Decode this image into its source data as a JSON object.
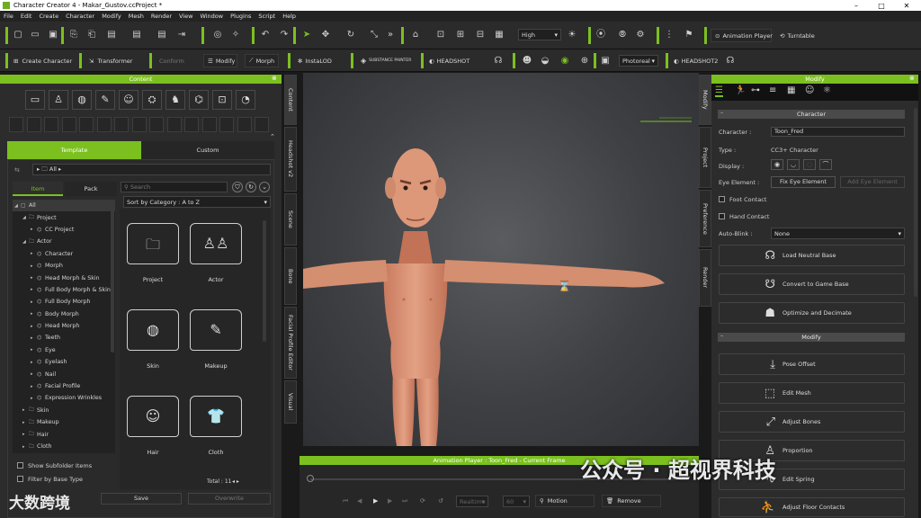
{
  "window": {
    "title": "Character Creator 4 - Makar_Gustov.ccProject *",
    "minimize": "–",
    "maximize": "□",
    "close": "✕"
  },
  "menu": [
    "File",
    "Edit",
    "Create",
    "Character",
    "Modify",
    "Mesh",
    "Render",
    "View",
    "Window",
    "Plugins",
    "Script",
    "Help"
  ],
  "toolbar1": {
    "quality": "High",
    "animation_player": "Animation Player",
    "turntable": "Turntable"
  },
  "toolbar2": {
    "create_character": "Create Character",
    "transformer": "Transformer",
    "conform": "Conform",
    "modify": "Modify",
    "morph": "Morph",
    "instalod": "InstaLOD",
    "substance_painter": "SUBSTANCE PAINTER",
    "headshot": "HEADSHOT",
    "render_mode": "Photoreal",
    "headshot2": "HEADSHOT2"
  },
  "content_panel": {
    "title": "Content",
    "tabs": {
      "template": "Template",
      "custom": "Custom"
    },
    "path": "All",
    "subtabs": {
      "item": "Item",
      "pack": "Pack"
    },
    "search_placeholder": "Search",
    "sort": "Sort by Category : A to Z",
    "tree": [
      {
        "label": "All",
        "depth": 0,
        "open": true
      },
      {
        "label": "Project",
        "depth": 1,
        "open": true
      },
      {
        "label": "CC Project",
        "depth": 2,
        "open": false
      },
      {
        "label": "Actor",
        "depth": 1,
        "open": true
      },
      {
        "label": "Character",
        "depth": 2,
        "open": false
      },
      {
        "label": "Morph",
        "depth": 2,
        "open": false
      },
      {
        "label": "Head Morph & Skin",
        "depth": 2,
        "open": false
      },
      {
        "label": "Full Body Morph & Skin",
        "depth": 2,
        "open": false
      },
      {
        "label": "Full Body Morph",
        "depth": 2,
        "open": false
      },
      {
        "label": "Body Morph",
        "depth": 2,
        "open": false
      },
      {
        "label": "Head Morph",
        "depth": 2,
        "open": false
      },
      {
        "label": "Teeth",
        "depth": 2,
        "open": false
      },
      {
        "label": "Eye",
        "depth": 2,
        "open": false
      },
      {
        "label": "Eyelash",
        "depth": 2,
        "open": false
      },
      {
        "label": "Nail",
        "depth": 2,
        "open": false
      },
      {
        "label": "Facial Profile",
        "depth": 2,
        "open": false
      },
      {
        "label": "Expression Wrinkles",
        "depth": 2,
        "open": false
      },
      {
        "label": "Skin",
        "depth": 1,
        "open": false
      },
      {
        "label": "Makeup",
        "depth": 1,
        "open": false
      },
      {
        "label": "Hair",
        "depth": 1,
        "open": false
      },
      {
        "label": "Cloth",
        "depth": 1,
        "open": false
      }
    ],
    "items": [
      {
        "label": "Project",
        "glyph": "🗀"
      },
      {
        "label": "Actor",
        "glyph": "♙♙"
      },
      {
        "label": "Skin",
        "glyph": "◍"
      },
      {
        "label": "Makeup",
        "glyph": "✎"
      },
      {
        "label": "Hair",
        "glyph": "☺"
      },
      {
        "label": "Cloth",
        "glyph": "👕"
      }
    ],
    "show_subfolder": "Show Subfolder Items",
    "filter_base_type": "Filter by Base Type",
    "total": "Total : 11",
    "save": "Save",
    "overwrite": "Overwrite"
  },
  "left_vtabs": [
    "Content",
    "Headshot v2",
    "Scene",
    "Bone",
    "Facial Profile Editor",
    "Visual"
  ],
  "right_vtabs": [
    "Modify",
    "Project",
    "Preference",
    "Render"
  ],
  "modify_panel": {
    "title": "Modify",
    "character_section": "Character",
    "character_label": "Character :",
    "character_value": "Toon_Fred",
    "type_label": "Type :",
    "type_value": "CC3+ Character",
    "display_label": "Display :",
    "eye_element_label": "Eye Element :",
    "fix_eye_element": "Fix Eye Element",
    "add_eye_element": "Add Eye Element",
    "foot_contact": "Foot Contact",
    "hand_contact": "Hand Contact",
    "auto_blink_label": "Auto-Blink :",
    "auto_blink_value": "None",
    "buttons1": [
      "Load Neutral Base",
      "Convert to Game Base",
      "Optimize and Decimate"
    ],
    "modify_section": "Modify",
    "buttons2": [
      "Pose Offset",
      "Edit Mesh",
      "Adjust Bones",
      "Proportion",
      "Edit Spring",
      "Adjust Floor Contacts"
    ]
  },
  "animation_player": {
    "title": "Animation Player : Toon_Fred - Current Frame",
    "realtime": "Realtime",
    "fps": "60",
    "motion": "Motion",
    "remove": "Remove"
  },
  "watermarks": {
    "left": "大数跨境",
    "right": "公众号 · 超视界科技"
  },
  "colors": {
    "accent": "#7bc01f",
    "panel": "#2c2c2c",
    "background": "#1a1a1a"
  }
}
